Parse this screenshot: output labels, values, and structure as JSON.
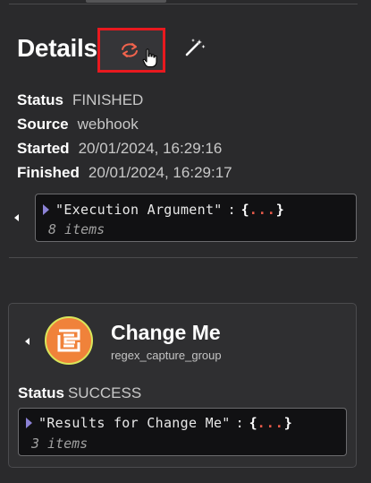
{
  "details": {
    "title": "Details",
    "fields": [
      {
        "key": "Status",
        "value": "FINISHED"
      },
      {
        "key": "Source",
        "value": "webhook"
      },
      {
        "key": "Started",
        "value": "20/01/2024, 16:29:16"
      },
      {
        "key": "Finished",
        "value": "20/01/2024, 16:29:17"
      }
    ],
    "json_viewer": {
      "key": "\"Execution Argument\"",
      "colon": ":",
      "open": "{",
      "dots": "...",
      "close": "}",
      "count": "8 items"
    }
  },
  "task": {
    "title": "Change Me",
    "subtitle": "regex_capture_group",
    "status_key": "Status",
    "status_value": "SUCCESS",
    "json_viewer": {
      "key": "\"Results for Change Me\"",
      "colon": ":",
      "open": "{",
      "dots": "...",
      "close": "}",
      "count": "3 items"
    }
  },
  "icons": {
    "refresh": "refresh-icon",
    "magic": "magic-wand-icon",
    "cursor": "hand-cursor-icon",
    "task": "regex-icon"
  },
  "colors": {
    "background": "#2a2a2c",
    "accent_red": "#e8191f",
    "refresh_orange": "#f0634d",
    "json_dots": "#e85b4a",
    "task_icon": "#f0823a"
  }
}
